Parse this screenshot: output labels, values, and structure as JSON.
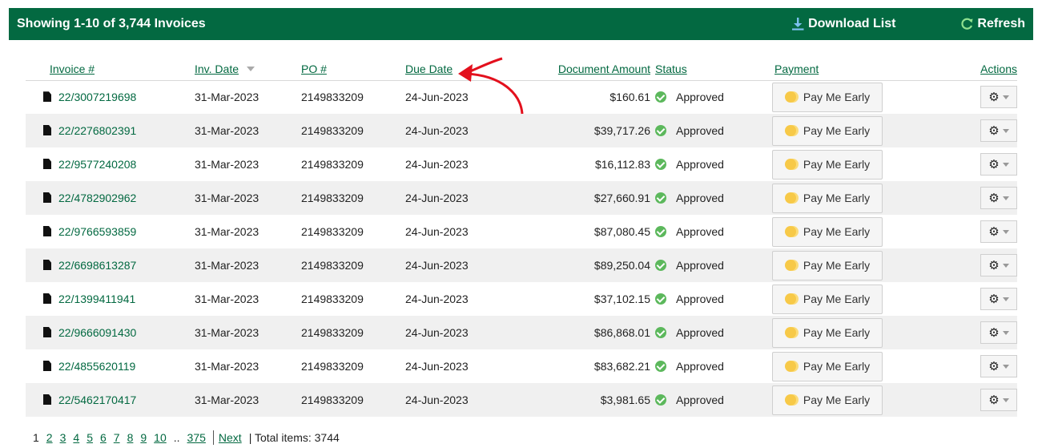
{
  "header": {
    "title": "Showing 1-10 of 3,744 Invoices",
    "download_label": "Download List",
    "refresh_label": "Refresh"
  },
  "columns": {
    "invoice": "Invoice #",
    "inv_date": "Inv. Date",
    "po": "PO #",
    "due_date": "Due Date",
    "amount": "Document Amount",
    "status": "Status",
    "payment": "Payment",
    "actions": "Actions"
  },
  "rows": [
    {
      "invoice": "22/3007219698",
      "inv_date": "31-Mar-2023",
      "po": "2149833209",
      "due_date": "24-Jun-2023",
      "amount": "$160.61",
      "status": "Approved",
      "payment": "Pay Me Early"
    },
    {
      "invoice": "22/2276802391",
      "inv_date": "31-Mar-2023",
      "po": "2149833209",
      "due_date": "24-Jun-2023",
      "amount": "$39,717.26",
      "status": "Approved",
      "payment": "Pay Me Early"
    },
    {
      "invoice": "22/9577240208",
      "inv_date": "31-Mar-2023",
      "po": "2149833209",
      "due_date": "24-Jun-2023",
      "amount": "$16,112.83",
      "status": "Approved",
      "payment": "Pay Me Early"
    },
    {
      "invoice": "22/4782902962",
      "inv_date": "31-Mar-2023",
      "po": "2149833209",
      "due_date": "24-Jun-2023",
      "amount": "$27,660.91",
      "status": "Approved",
      "payment": "Pay Me Early"
    },
    {
      "invoice": "22/9766593859",
      "inv_date": "31-Mar-2023",
      "po": "2149833209",
      "due_date": "24-Jun-2023",
      "amount": "$87,080.45",
      "status": "Approved",
      "payment": "Pay Me Early"
    },
    {
      "invoice": "22/6698613287",
      "inv_date": "31-Mar-2023",
      "po": "2149833209",
      "due_date": "24-Jun-2023",
      "amount": "$89,250.04",
      "status": "Approved",
      "payment": "Pay Me Early"
    },
    {
      "invoice": "22/1399411941",
      "inv_date": "31-Mar-2023",
      "po": "2149833209",
      "due_date": "24-Jun-2023",
      "amount": "$37,102.15",
      "status": "Approved",
      "payment": "Pay Me Early"
    },
    {
      "invoice": "22/9666091430",
      "inv_date": "31-Mar-2023",
      "po": "2149833209",
      "due_date": "24-Jun-2023",
      "amount": "$86,868.01",
      "status": "Approved",
      "payment": "Pay Me Early"
    },
    {
      "invoice": "22/4855620119",
      "inv_date": "31-Mar-2023",
      "po": "2149833209",
      "due_date": "24-Jun-2023",
      "amount": "$83,682.21",
      "status": "Approved",
      "payment": "Pay Me Early"
    },
    {
      "invoice": "22/5462170417",
      "inv_date": "31-Mar-2023",
      "po": "2149833209",
      "due_date": "24-Jun-2023",
      "amount": "$3,981.65",
      "status": "Approved",
      "payment": "Pay Me Early"
    }
  ],
  "pager": {
    "current": "1",
    "pages": [
      "2",
      "3",
      "4",
      "5",
      "6",
      "7",
      "8",
      "9",
      "10"
    ],
    "ellipsis": "..",
    "last": "375",
    "next": "Next",
    "total": "| Total items: 3744"
  },
  "colors": {
    "brand": "#036941",
    "status_ok": "#5cb85c",
    "annotation_arrow": "#e3101d"
  }
}
